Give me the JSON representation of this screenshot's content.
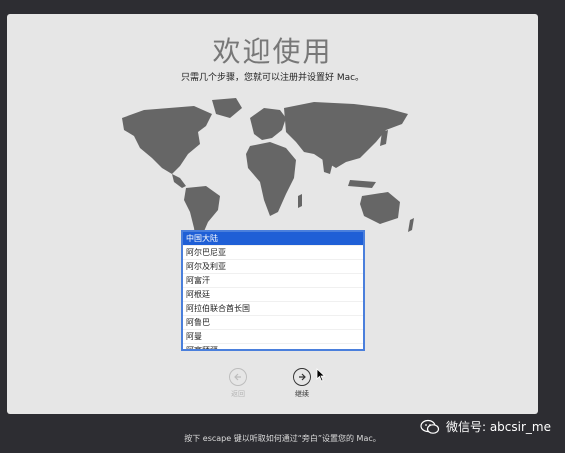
{
  "setup": {
    "title": "欢迎使用",
    "subtitle": "只需几个步骤，您就可以注册并设置好 Mac。",
    "countries": [
      "中国大陆",
      "阿尔巴尼亚",
      "阿尔及利亚",
      "阿富汗",
      "阿根廷",
      "阿拉伯联合酋长国",
      "阿鲁巴",
      "阿曼",
      "阿塞拜疆"
    ],
    "selected_country": "中国大陆",
    "back_label": "返回",
    "continue_label": "继续",
    "footer": "按下 escape 键以听取如何通过“旁白”设置您的 Mac。"
  },
  "watermark": {
    "text": "微信号: abcsir_me"
  },
  "colors": {
    "selection": "#1f5fd6",
    "panel": "#e6e6e6",
    "background": "#2d2d32"
  }
}
